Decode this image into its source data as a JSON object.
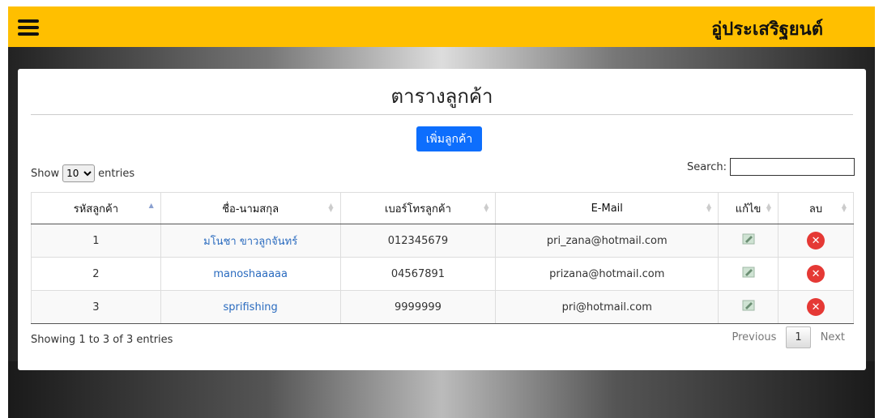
{
  "header": {
    "brand": "อู่ประเสริฐยนต์"
  },
  "card": {
    "title": "ตารางลูกค้า",
    "add_button": "เพิ่มลูกค้า"
  },
  "length": {
    "show": "Show",
    "value": "10",
    "entries": "entries"
  },
  "search": {
    "label": "Search:"
  },
  "table": {
    "columns": [
      "รหัสลูกค้า",
      "ชื่อ-นามสกุล",
      "เบอร์โทรลูกค้า",
      "E-Mail",
      "แก้ไข",
      "ลบ"
    ],
    "rows": [
      {
        "id": "1",
        "name": "มโนชา ขาวลูกจันทร์",
        "phone": "012345679",
        "email": "pri_zana@hotmail.com"
      },
      {
        "id": "2",
        "name": "manoshaaaaa",
        "phone": "04567891",
        "email": "prizana@hotmail.com"
      },
      {
        "id": "3",
        "name": "sprifishing",
        "phone": "9999999",
        "email": "pri@hotmail.com"
      }
    ]
  },
  "footer": {
    "info": "Showing 1 to 3 of 3 entries",
    "previous": "Previous",
    "page": "1",
    "next": "Next"
  },
  "colors": {
    "topbar": "#ffbf00",
    "primary_button": "#0d6efd",
    "delete": "#e53935",
    "link": "#2a6bbf"
  },
  "icons": {
    "menu": "hamburger-icon",
    "edit": "edit-icon",
    "delete": "delete-icon"
  }
}
